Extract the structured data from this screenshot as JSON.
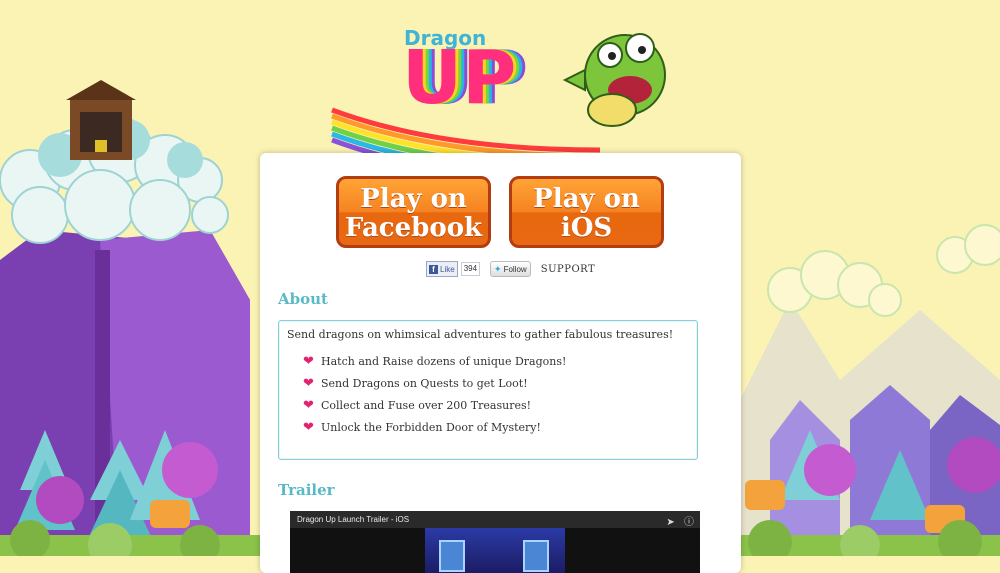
{
  "logo": {
    "word1": "Dragon",
    "word2": "UP"
  },
  "buttons": {
    "facebook": {
      "line1": "Play on",
      "line2": "Facebook"
    },
    "ios": {
      "line1": "Play on",
      "line2": "iOS"
    }
  },
  "social": {
    "fb_like": "Like",
    "fb_count": "394",
    "tw_follow": "Follow",
    "support": "SUPPORT"
  },
  "about": {
    "title": "About",
    "intro": "Send dragons on whimsical adventures to gather fabulous treasures!",
    "items": [
      "Hatch and Raise dozens of unique Dragons!",
      "Send Dragons on Quests to get Loot!",
      "Collect and Fuse over 200 Treasures!",
      "Unlock the Forbidden Door of Mystery!"
    ]
  },
  "trailer": {
    "title": "Trailer",
    "video_title": "Dragon Up Launch Trailer - iOS"
  },
  "colors": {
    "background": "#fbf3b4",
    "accent_teal": "#59b9c7",
    "button_orange": "#f58220",
    "heart_pink": "#e2246e"
  }
}
